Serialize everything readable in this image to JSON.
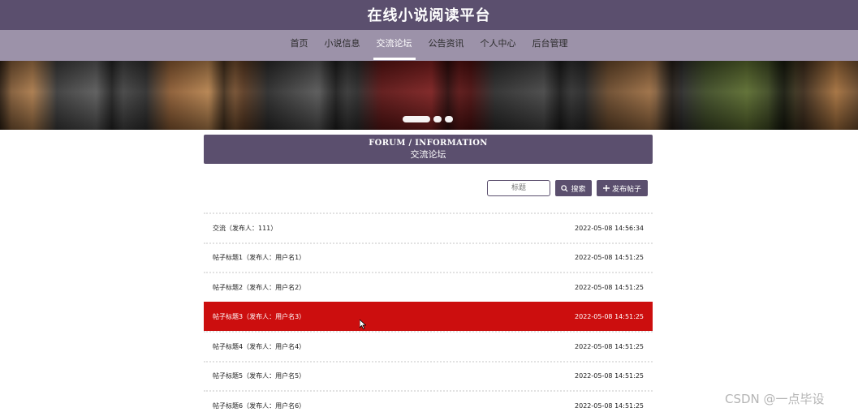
{
  "header": {
    "site_title": "在线小说阅读平台"
  },
  "nav": {
    "items": [
      {
        "label": "首页"
      },
      {
        "label": "小说信息"
      },
      {
        "label": "交流论坛"
      },
      {
        "label": "公告资讯"
      },
      {
        "label": "个人中心"
      },
      {
        "label": "后台管理"
      }
    ],
    "active_index": 2
  },
  "carousel": {
    "slide_count": 3,
    "active_slide": 1
  },
  "section": {
    "title_en": "FORUM / INFORMATION",
    "title_cn": "交流论坛"
  },
  "toolbar": {
    "search_placeholder": "标题",
    "search_label": "搜索",
    "post_label": "发布帖子",
    "search_icon": "search-icon",
    "post_icon": "plus-icon"
  },
  "posts": [
    {
      "title": "交流（发布人：111）",
      "time": "2022-05-08 14:56:34"
    },
    {
      "title": "帖子标题1（发布人：用户名1）",
      "time": "2022-05-08 14:51:25"
    },
    {
      "title": "帖子标题2（发布人：用户名2）",
      "time": "2022-05-08 14:51:25"
    },
    {
      "title": "帖子标题3（发布人：用户名3）",
      "time": "2022-05-08 14:51:25"
    },
    {
      "title": "帖子标题4（发布人：用户名4）",
      "time": "2022-05-08 14:51:25"
    },
    {
      "title": "帖子标题5（发布人：用户名5）",
      "time": "2022-05-08 14:51:25"
    },
    {
      "title": "帖子标题6（发布人：用户名6）",
      "time": "2022-05-08 14:51:25"
    }
  ],
  "highlighted_post_index": 3,
  "watermark": "CSDN @一点毕设",
  "colors": {
    "primary": "#5b4f6e",
    "nav_bg": "#9c92a9",
    "highlight": "#cc0e0e"
  }
}
